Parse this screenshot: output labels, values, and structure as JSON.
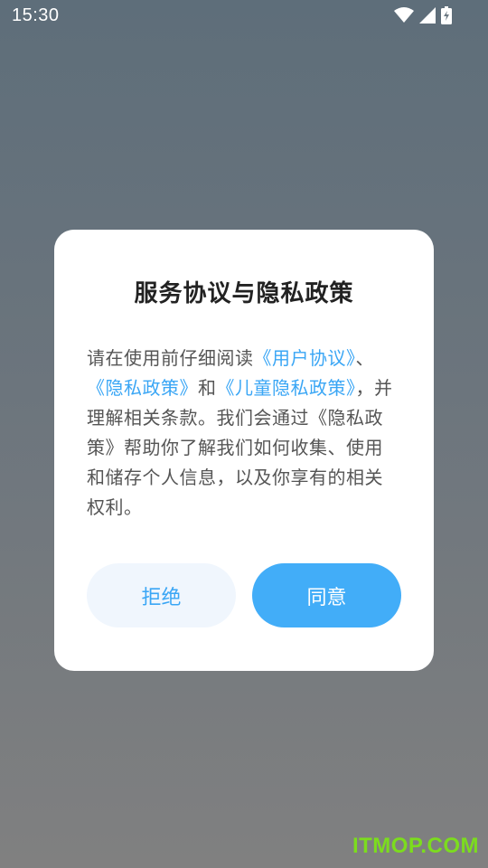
{
  "status_bar": {
    "time": "15:30",
    "icons": [
      "wifi-icon",
      "cellular-signal-icon",
      "battery-charging-icon"
    ]
  },
  "dialog": {
    "title": "服务协议与隐私政策",
    "body": {
      "text_1": "请在使用前仔细阅读",
      "link_user_agreement": "《用户协议》",
      "text_2": "、",
      "link_privacy_policy": "《隐私政策》",
      "text_3": "和",
      "link_child_privacy_policy": "《儿童隐私政策》",
      "text_4": "，并理解相关条款。我们会通过《隐私政策》帮助你了解我们如何收集、使用和储存个人信息，以及你享有的相关权利。"
    },
    "reject_label": "拒绝",
    "agree_label": "同意"
  },
  "watermark": {
    "text": "ITMOP.COM"
  },
  "colors": {
    "accent": "#3aa6f5",
    "agree_button_bg": "#42adf8",
    "reject_button_bg": "#f0f6fd",
    "watermark": "#7cdc1e"
  }
}
